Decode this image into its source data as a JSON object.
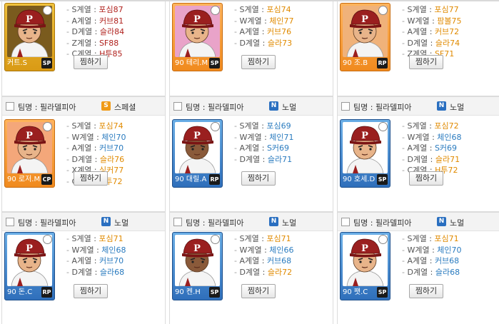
{
  "colors": {
    "orange": "#e08a00",
    "red": "#b0221e",
    "blue": "#2a7bbf",
    "cap_red": "#9a1f1f",
    "skin": "#e8b48a",
    "skin_dark": "#8a5a3a"
  },
  "cards": [
    {
      "row": 0,
      "col": 0,
      "header": null,
      "caption": "커트.S",
      "pos": "SP",
      "frame": "gold",
      "corner": "star-icon",
      "skin": "skin",
      "bg": "#7a5b1e",
      "stats": [
        {
          "k": "S계열",
          "v": "포심87",
          "c": "red"
        },
        {
          "k": "A계열",
          "v": "커브81",
          "c": "red"
        },
        {
          "k": "D계열",
          "v": "슬라84",
          "c": "red"
        },
        {
          "k": "Z계열",
          "v": "SF88",
          "c": "red"
        },
        {
          "k": "C계열",
          "v": "H투85",
          "c": "red"
        }
      ],
      "button": "찜하기"
    },
    {
      "row": 0,
      "col": 1,
      "header": null,
      "caption": "90 테리.M",
      "pos": "SP",
      "frame": "orange",
      "corner": "ball-icon",
      "skin": "skin",
      "bg": "#e9a3c9",
      "stats": [
        {
          "k": "S계열",
          "v": "포심74",
          "c": "orange"
        },
        {
          "k": "W계열",
          "v": "체인77",
          "c": "orange"
        },
        {
          "k": "A계열",
          "v": "커브76",
          "c": "orange"
        },
        {
          "k": "D계열",
          "v": "슬라73",
          "c": "orange"
        }
      ],
      "button": "찜하기"
    },
    {
      "row": 0,
      "col": 2,
      "header": null,
      "caption": "90 조.B",
      "pos": "RP",
      "frame": "orange",
      "corner": "star-icon",
      "skin": "skin",
      "bg": "#f0b27a",
      "stats": [
        {
          "k": "S계열",
          "v": "포심77",
          "c": "orange"
        },
        {
          "k": "W계열",
          "v": "팜볼75",
          "c": "orange"
        },
        {
          "k": "A계열",
          "v": "커브72",
          "c": "orange"
        },
        {
          "k": "D계열",
          "v": "슬라74",
          "c": "orange"
        },
        {
          "k": "Z계열",
          "v": "SF71",
          "c": "orange"
        }
      ],
      "button": "찜하기"
    },
    {
      "row": 1,
      "col": 0,
      "header": {
        "team": "팀명 : 필라델피아",
        "badge": "S",
        "badge_color": "#f09a16",
        "label": "스페셜"
      },
      "caption": "90 로저.M",
      "pos": "CP",
      "frame": "orange",
      "corner": "ball-icon",
      "skin": "skin",
      "bg": "#f4a77a",
      "stats": [
        {
          "k": "S계열",
          "v": "포심74",
          "c": "orange"
        },
        {
          "k": "W계열",
          "v": "체인70",
          "c": "blue"
        },
        {
          "k": "A계열",
          "v": "커브70",
          "c": "blue"
        },
        {
          "k": "D계열",
          "v": "슬라76",
          "c": "orange"
        },
        {
          "k": "X계열",
          "v": "싱커77",
          "c": "orange"
        },
        {
          "k": "C계열",
          "v": "H투72",
          "c": "orange"
        }
      ],
      "button": "찜하기"
    },
    {
      "row": 1,
      "col": 1,
      "header": {
        "team": "팀명 : 필라델피아",
        "badge": "N",
        "badge_color": "#2a6fc0",
        "label": "노멀"
      },
      "caption": "90 대릴.A",
      "pos": "RP",
      "frame": "blue",
      "corner": "snowflake-icon",
      "skin": "skin_dark",
      "bg": "#ffffff",
      "stats": [
        {
          "k": "S계열",
          "v": "포심69",
          "c": "blue"
        },
        {
          "k": "W계열",
          "v": "체인71",
          "c": "blue"
        },
        {
          "k": "A계열",
          "v": "S커69",
          "c": "blue"
        },
        {
          "k": "D계열",
          "v": "슬라71",
          "c": "blue"
        }
      ],
      "button": "찜하기"
    },
    {
      "row": 1,
      "col": 2,
      "header": {
        "team": "팀명 : 필라델피아",
        "badge": "N",
        "badge_color": "#2a6fc0",
        "label": "노멀"
      },
      "caption": "90 호세.D",
      "pos": "SP",
      "frame": "blue",
      "corner": "ball-icon",
      "skin": "skin",
      "bg": "#ffffff",
      "stats": [
        {
          "k": "S계열",
          "v": "포심72",
          "c": "orange"
        },
        {
          "k": "W계열",
          "v": "체인68",
          "c": "blue"
        },
        {
          "k": "A계열",
          "v": "S커69",
          "c": "blue"
        },
        {
          "k": "D계열",
          "v": "슬라71",
          "c": "orange"
        },
        {
          "k": "C계열",
          "v": "H투72",
          "c": "orange"
        }
      ],
      "button": "찜하기"
    },
    {
      "row": 2,
      "col": 0,
      "header": {
        "team": "팀명 : 필라델피아",
        "badge": "N",
        "badge_color": "#2a6fc0",
        "label": "노멀"
      },
      "caption": "90 돈.C",
      "pos": "RP",
      "frame": "blue",
      "corner": "ball-icon",
      "skin": "skin",
      "bg": "#ffffff",
      "stats": [
        {
          "k": "S계열",
          "v": "포심71",
          "c": "orange"
        },
        {
          "k": "W계열",
          "v": "체인68",
          "c": "blue"
        },
        {
          "k": "A계열",
          "v": "커브70",
          "c": "blue"
        },
        {
          "k": "D계열",
          "v": "슬라68",
          "c": "blue"
        }
      ],
      "button": "찜하기"
    },
    {
      "row": 2,
      "col": 1,
      "header": {
        "team": "팀명 : 필라델피아",
        "badge": "N",
        "badge_color": "#2a6fc0",
        "label": "노멀"
      },
      "caption": "90 켄.H",
      "pos": "SP",
      "frame": "blue",
      "corner": "ball-icon",
      "skin": "skin_dark",
      "bg": "#ffffff",
      "stats": [
        {
          "k": "S계열",
          "v": "포심71",
          "c": "orange"
        },
        {
          "k": "W계열",
          "v": "체인66",
          "c": "blue"
        },
        {
          "k": "A계열",
          "v": "커브68",
          "c": "blue"
        },
        {
          "k": "D계열",
          "v": "슬라72",
          "c": "orange"
        }
      ],
      "button": "찜하기"
    },
    {
      "row": 2,
      "col": 2,
      "header": {
        "team": "팀명 : 필라델피아",
        "badge": "N",
        "badge_color": "#2a6fc0",
        "label": "노멀"
      },
      "caption": "90 팻.C",
      "pos": "SP",
      "frame": "blue",
      "corner": "ball-icon",
      "skin": "skin",
      "bg": "#ffffff",
      "stats": [
        {
          "k": "S계열",
          "v": "포심71",
          "c": "orange"
        },
        {
          "k": "W계열",
          "v": "체인70",
          "c": "blue"
        },
        {
          "k": "A계열",
          "v": "커브68",
          "c": "blue"
        },
        {
          "k": "D계열",
          "v": "슬라68",
          "c": "blue"
        }
      ],
      "button": "찜하기"
    }
  ]
}
